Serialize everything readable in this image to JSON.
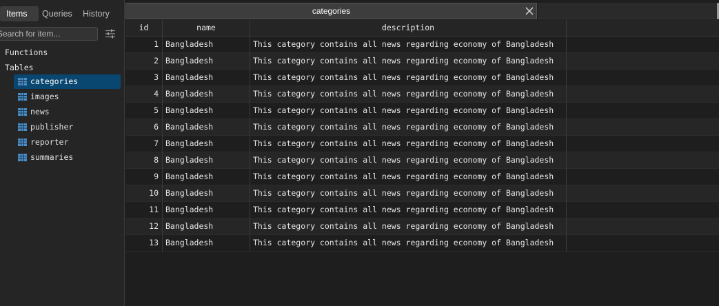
{
  "sidebar": {
    "tabs": [
      {
        "label": "Items"
      },
      {
        "label": "Queries"
      },
      {
        "label": "History"
      }
    ],
    "search": {
      "placeholder": "Search for item...",
      "value": ""
    },
    "filter_icon": "sliders-icon",
    "functions_label": "Functions",
    "tables_label": "Tables",
    "tables": [
      {
        "label": "categories",
        "selected": true
      },
      {
        "label": "images"
      },
      {
        "label": "news"
      },
      {
        "label": "publisher"
      },
      {
        "label": "reporter"
      },
      {
        "label": "summaries"
      }
    ]
  },
  "tab": {
    "title": "categories",
    "close_icon": "close-icon"
  },
  "grid": {
    "columns": [
      "id",
      "name",
      "description"
    ],
    "rows": [
      [
        "1",
        "Bangladesh",
        "This category contains all news regarding economy of Bangladesh"
      ],
      [
        "2",
        "Bangladesh",
        "This category contains all news regarding economy of Bangladesh"
      ],
      [
        "3",
        "Bangladesh",
        "This category contains all news regarding economy of Bangladesh"
      ],
      [
        "4",
        "Bangladesh",
        "This category contains all news regarding economy of Bangladesh"
      ],
      [
        "5",
        "Bangladesh",
        "This category contains all news regarding economy of Bangladesh"
      ],
      [
        "6",
        "Bangladesh",
        "This category contains all news regarding economy of Bangladesh"
      ],
      [
        "7",
        "Bangladesh",
        "This category contains all news regarding economy of Bangladesh"
      ],
      [
        "8",
        "Bangladesh",
        "This category contains all news regarding economy of Bangladesh"
      ],
      [
        "9",
        "Bangladesh",
        "This category contains all news regarding economy of Bangladesh"
      ],
      [
        "10",
        "Bangladesh",
        "This category contains all news regarding economy of Bangladesh"
      ],
      [
        "11",
        "Bangladesh",
        "This category contains all news regarding economy of Bangladesh"
      ],
      [
        "12",
        "Bangladesh",
        "This category contains all news regarding economy of Bangladesh"
      ],
      [
        "13",
        "Bangladesh",
        "This category contains all news regarding economy of Bangladesh"
      ]
    ]
  },
  "colors": {
    "background": "#1e1e1e",
    "sidebar": "#252526",
    "selection": "#094771",
    "table_icon": "#4a8fc9"
  }
}
